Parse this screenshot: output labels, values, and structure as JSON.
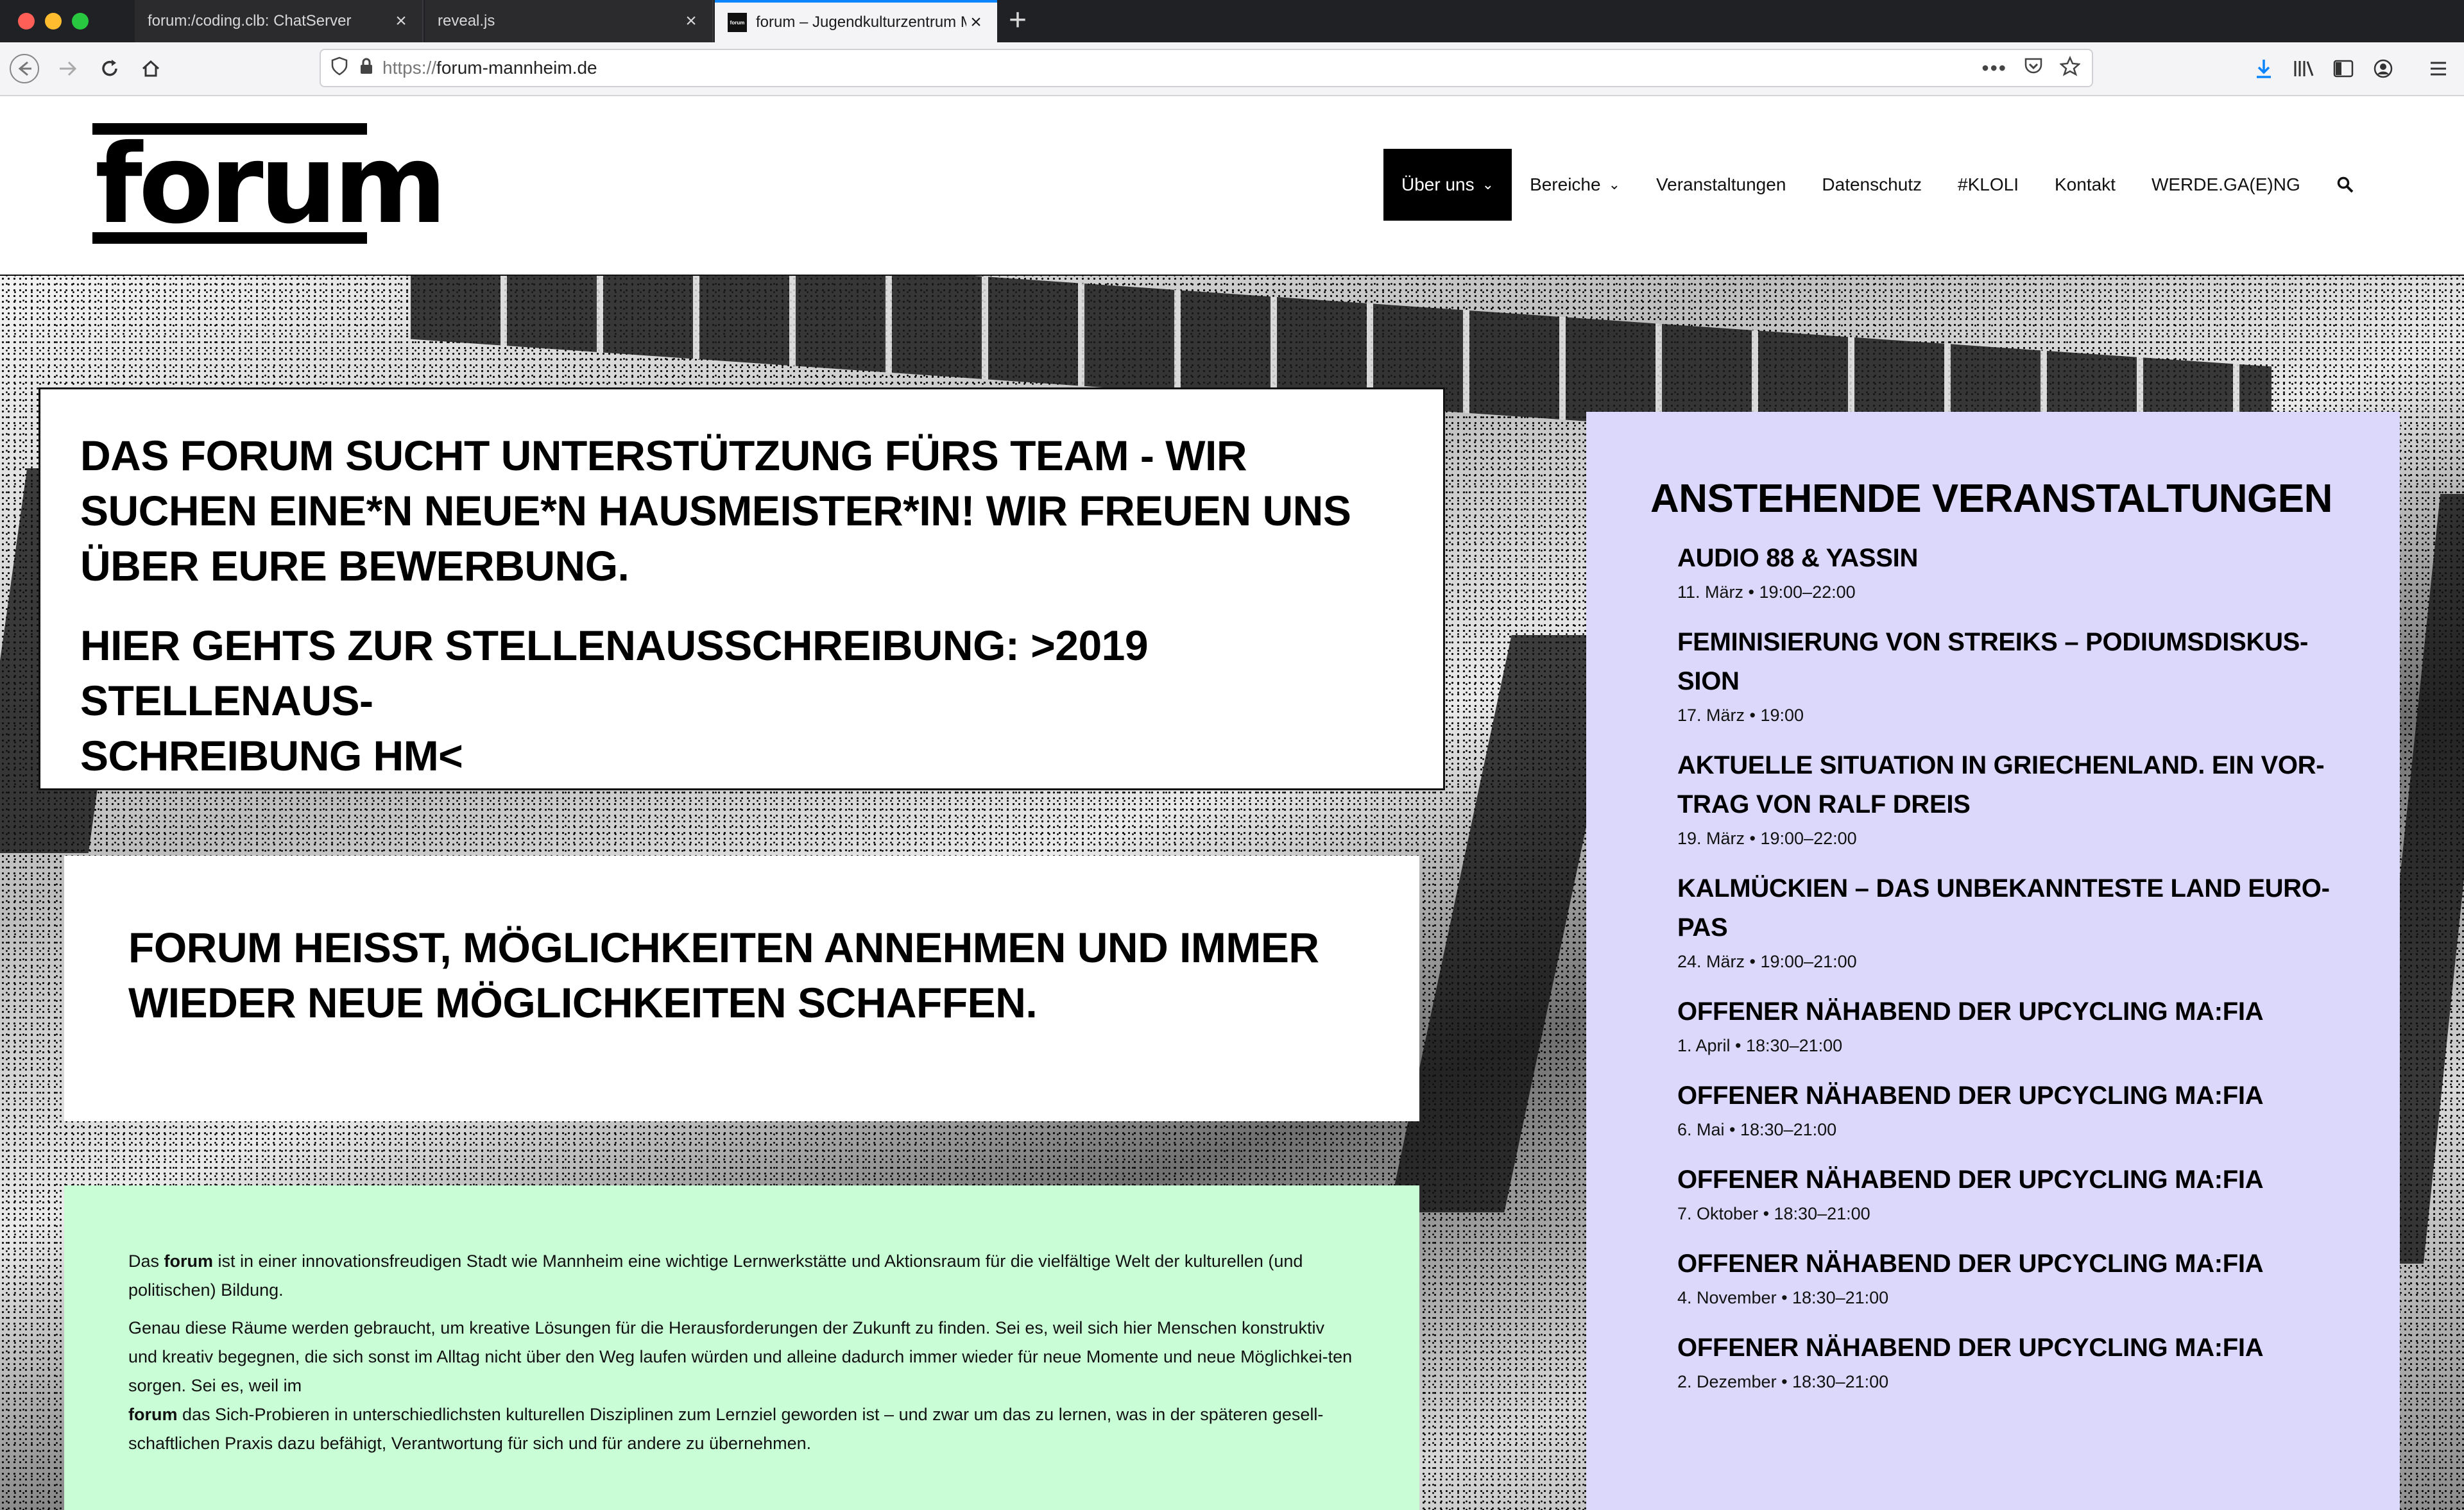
{
  "browser": {
    "tabs": [
      {
        "title": "forum:/coding.clb: ChatServer",
        "active": false
      },
      {
        "title": "reveal.js",
        "active": false
      },
      {
        "title": "forum – Jugendkulturzentrum M",
        "active": true
      }
    ],
    "url_protocol": "https://",
    "url_host": "forum-mannheim.de"
  },
  "site": {
    "logo_text": "forum",
    "nav": [
      {
        "label": "Über uns",
        "active": true,
        "dropdown": true
      },
      {
        "label": "Bereiche",
        "active": false,
        "dropdown": true
      },
      {
        "label": "Veranstaltungen",
        "active": false,
        "dropdown": false
      },
      {
        "label": "Datenschutz",
        "active": false,
        "dropdown": false
      },
      {
        "label": "#KLOLI",
        "active": false,
        "dropdown": false
      },
      {
        "label": "Kontakt",
        "active": false,
        "dropdown": false
      },
      {
        "label": "WERDE.GA(E)NG",
        "active": false,
        "dropdown": false
      }
    ]
  },
  "notice": {
    "paragraph1": "DAS FORUM SUCHT UNTERSTÜTZUNG FÜRS TEAM - WIR SUCHEN EINE*N NEUE*N HAUSMEISTER*IN! WIR FREUEN UNS ÜBER EURE BEWERBUNG.",
    "paragraph2_line1": "HIER GEHTS ZUR STELLENAUSSCHREIBUNG: >2019 STELLENAUS-",
    "paragraph2_line2": "SCHREIBUNG HM<"
  },
  "motto": {
    "text": "FORUM HEISST, MÖGLICHKEITEN ANNEHMEN UND IMMER WIEDER NEUE MÖGLICHKEITEN SCHAFFEN."
  },
  "about": {
    "p1_bold": "forum",
    "p1_pre": "Das ",
    "p1_post": " ist in einer innovationsfreudigen Stadt wie Mannheim eine wichtige Lernwerkstätte und Aktionsraum  für die vielfältige Welt der kulturellen (und politischen) Bildung.",
    "p2": "Genau diese Räume werden gebraucht, um kreative Lösungen für die Herausforderungen der Zukunft zu finden. Sei es, weil sich hier Menschen konstruktiv und kreativ begegnen, die sich sonst im Alltag nicht über den Weg laufen würden und alleine dadurch immer wieder für neue Momente und neue Möglichkei-ten sorgen. Sei es, weil im",
    "p3_bold": "forum",
    "p3_post": " das Sich-Probieren in unterschiedlichsten kulturellen Disziplinen zum Lernziel geworden ist – und zwar um das zu lernen, was in der späteren gesell-schaftlichen Praxis dazu befähigt, Verantwortung für sich und für andere zu übernehmen."
  },
  "events": {
    "heading": "ANSTEHENDE VERANSTALTUNGEN",
    "items": [
      {
        "title": "AUDIO 88 & YASSIN",
        "date": "11. März • 19:00–22:00"
      },
      {
        "title": "FEMINISIERUNG VON STREIKS – PODIUMSDISKUS-SION",
        "date": "17. März • 19:00"
      },
      {
        "title": "AKTUELLE SITUATION IN GRIECHENLAND. EIN VOR-TRAG VON RALF DREIS",
        "date": "19. März • 19:00–22:00"
      },
      {
        "title": "KALMÜCKIEN – DAS UNBEKANNTESTE LAND EURO-PAS",
        "date": "24. März • 19:00–21:00"
      },
      {
        "title": "OFFENER NÄHABEND DER UPCYCLING MA:FIA",
        "date": "1. April • 18:30–21:00"
      },
      {
        "title": "OFFENER NÄHABEND DER UPCYCLING MA:FIA",
        "date": "6. Mai • 18:30–21:00"
      },
      {
        "title": "OFFENER NÄHABEND DER UPCYCLING MA:FIA",
        "date": "7. Oktober • 18:30–21:00"
      },
      {
        "title": "OFFENER NÄHABEND DER UPCYCLING MA:FIA",
        "date": "4. November • 18:30–21:00"
      },
      {
        "title": "OFFENER NÄHABEND DER UPCYCLING MA:FIA",
        "date": "2. Dezember • 18:30–21:00"
      }
    ]
  },
  "colors": {
    "events_bg": "#dcd8fc",
    "about_bg": "#c9fdd6",
    "nav_active_bg": "#000000",
    "tab_accent": "#0a84ff"
  }
}
